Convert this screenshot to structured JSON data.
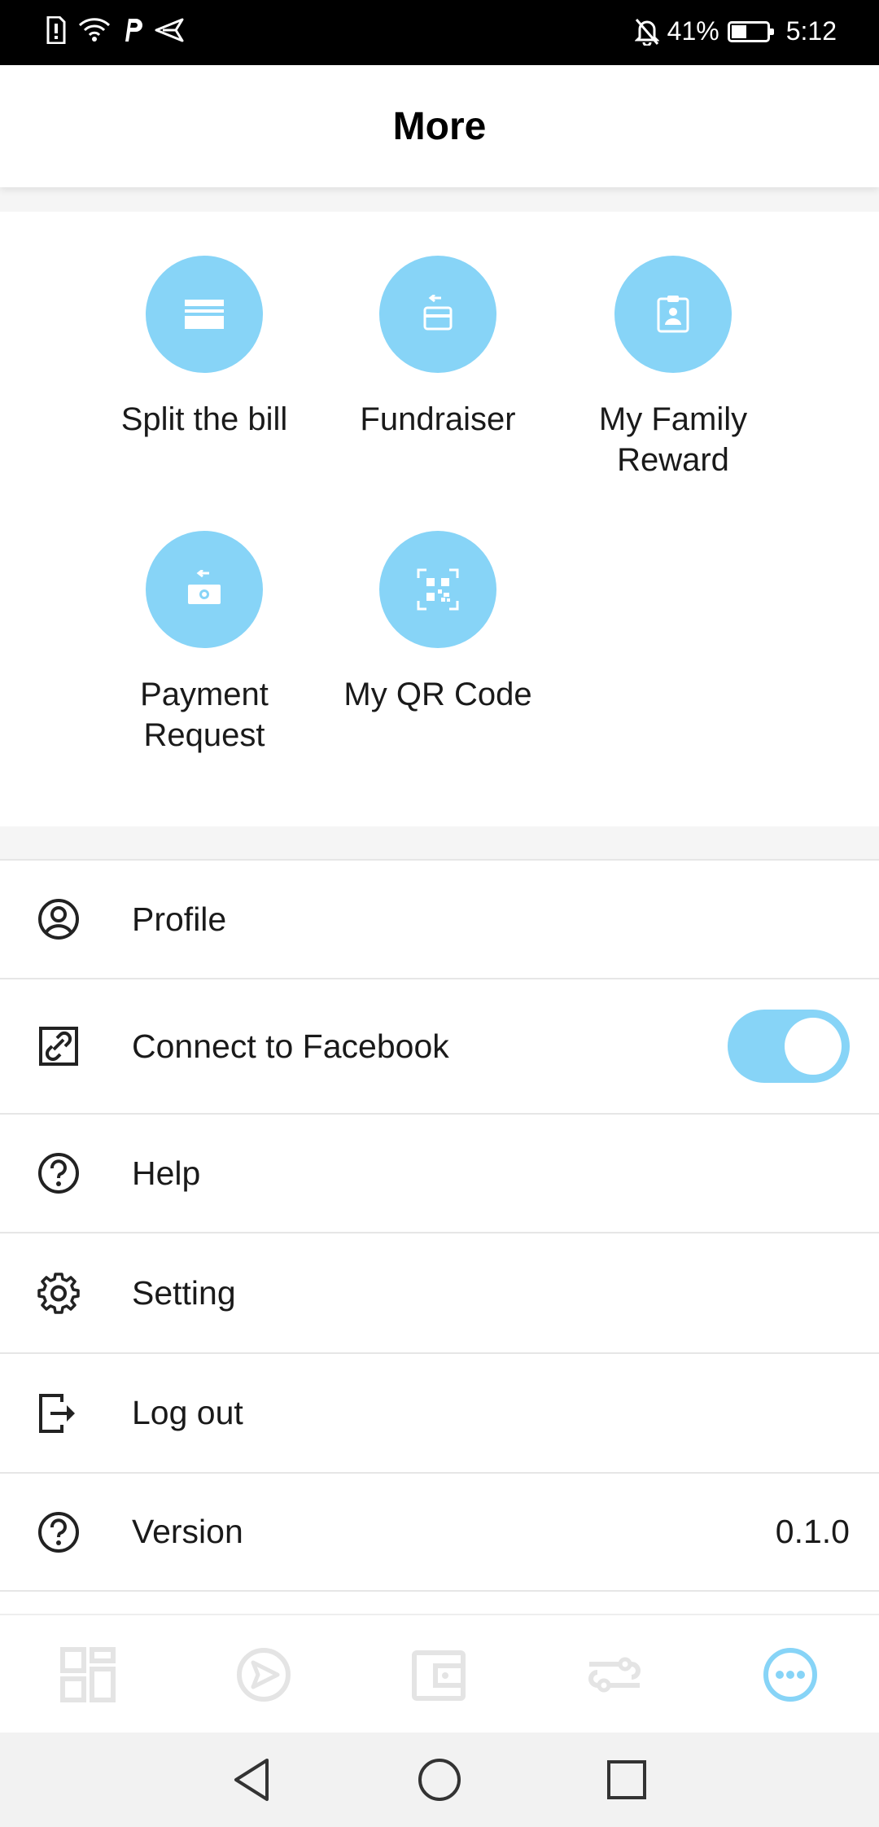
{
  "status_bar": {
    "battery_percent": "41%",
    "time": "5:12"
  },
  "header": {
    "title": "More"
  },
  "features": [
    {
      "label": "Split the bill",
      "icon": "card-icon"
    },
    {
      "label": "Fundraiser",
      "icon": "card-transfer-icon"
    },
    {
      "label": "My Family Reward",
      "icon": "clipboard-person-icon"
    },
    {
      "label": "Payment Request",
      "icon": "cash-request-icon"
    },
    {
      "label": "My QR Code",
      "icon": "qr-code-icon"
    }
  ],
  "menu": {
    "profile": {
      "label": "Profile",
      "icon": "user-circle-icon"
    },
    "facebook": {
      "label": "Connect to Facebook",
      "icon": "link-icon",
      "toggle_on": true
    },
    "help": {
      "label": "Help",
      "icon": "question-circle-icon"
    },
    "setting": {
      "label": "Setting",
      "icon": "gear-icon"
    },
    "logout": {
      "label": "Log out",
      "icon": "logout-icon"
    },
    "version": {
      "label": "Version",
      "value": "0.1.0",
      "icon": "question-circle-icon"
    }
  },
  "tabs": [
    {
      "name": "dashboard",
      "icon": "grid-icon",
      "active": false
    },
    {
      "name": "send",
      "icon": "send-circle-icon",
      "active": false
    },
    {
      "name": "wallet",
      "icon": "wallet-icon",
      "active": false
    },
    {
      "name": "transfer",
      "icon": "transfer-icon",
      "active": false
    },
    {
      "name": "more",
      "icon": "more-dots-icon",
      "active": true
    }
  ],
  "colors": {
    "accent": "#87d4f7",
    "inactive_tab": "#e4e4e4",
    "text": "#1a1a1a"
  }
}
